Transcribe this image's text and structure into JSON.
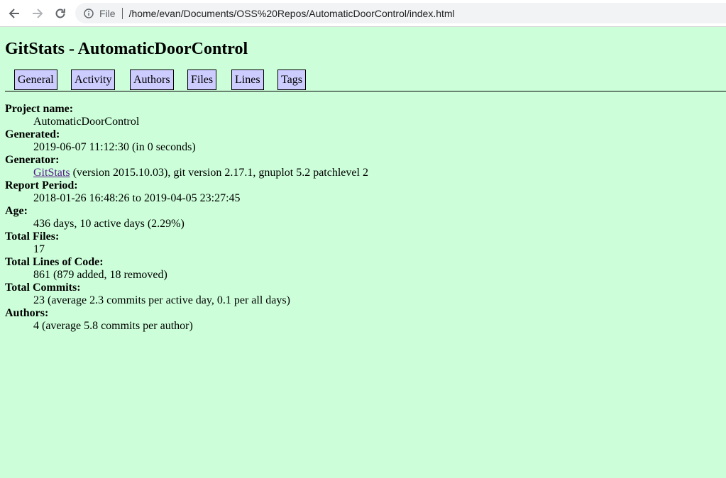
{
  "browser": {
    "scheme": "File",
    "url": "/home/evan/Documents/OSS%20Repos/AutomaticDoorControl/index.html"
  },
  "page": {
    "title": "GitStats - AutomaticDoorControl",
    "tabs": [
      "General",
      "Activity",
      "Authors",
      "Files",
      "Lines",
      "Tags"
    ],
    "fields": {
      "project_name_label": "Project name:",
      "project_name": "AutomaticDoorControl",
      "generated_label": "Generated:",
      "generated": "2019-06-07 11:12:30 (in 0 seconds)",
      "generator_label": "Generator:",
      "generator_link": "GitStats",
      "generator_rest": " (version 2015.10.03), git version 2.17.1, gnuplot 5.2 patchlevel 2",
      "report_period_label": "Report Period:",
      "report_period": "2018-01-26 16:48:26 to 2019-04-05 23:27:45",
      "age_label": "Age:",
      "age": "436 days, 10 active days (2.29%)",
      "total_files_label": "Total Files:",
      "total_files": "17",
      "total_loc_label": "Total Lines of Code:",
      "total_loc": "861 (879 added, 18 removed)",
      "total_commits_label": "Total Commits:",
      "total_commits": "23 (average 2.3 commits per active day, 0.1 per all days)",
      "authors_label": "Authors:",
      "authors": "4 (average 5.8 commits per author)"
    }
  },
  "colors": {
    "page_background": "#ccffd9",
    "tab_background": "#ccccff",
    "link": "#551a8b"
  },
  "icons": [
    "back-arrow-icon",
    "forward-arrow-icon",
    "reload-icon",
    "info-icon"
  ]
}
